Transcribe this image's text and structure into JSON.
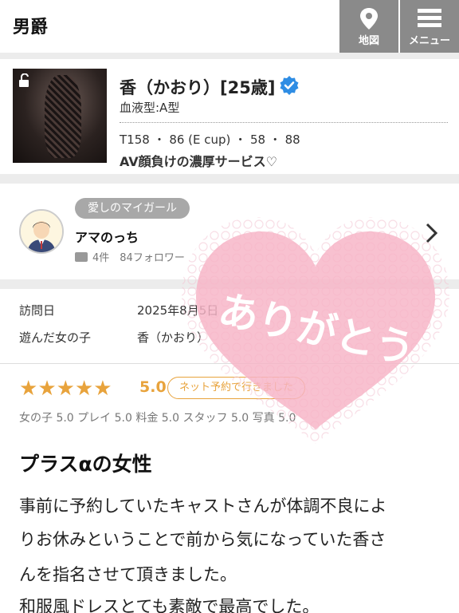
{
  "header": {
    "title": "男爵",
    "map_label": "地図",
    "menu_label": "メニュー"
  },
  "profile": {
    "name": "香（かおり）[25歳]",
    "blood": "血液型:A型",
    "stats": "T158 ・ 86 (E cup) ・ 58 ・ 88",
    "catch": "AV顔負けの濃厚サービス♡"
  },
  "reviewer": {
    "badge": "愛しのマイガール",
    "name": "アマのっち",
    "meta": "4件　84フォロワー"
  },
  "visit": {
    "date_label": "訪問日",
    "date_value": "2025年8月5日",
    "girl_label": "遊んだ女の子",
    "girl_value": "香（かおり）"
  },
  "rating": {
    "stars": 5,
    "score": "5.0",
    "badge": "ネット予約で行きました",
    "subscores": "女の子 5.0 プレイ 5.0 料金 5.0 スタッフ 5.0 写真 5.0"
  },
  "review": {
    "title": "プラスαの女性",
    "lines": [
      "事前に予約していたキャストさんが体調不良によ",
      "りお休みということで前から気になっていた香さ",
      "んを指名させて頂きました。",
      "和服風ドレスとても素敵で最高でした。"
    ]
  },
  "stamp_text": "ありがとう",
  "colors": {
    "header_button": "#8a8a8a",
    "star": "#e8a33c",
    "stamp_pink": "#f6b3c6",
    "verified_blue": "#2f8de4"
  }
}
